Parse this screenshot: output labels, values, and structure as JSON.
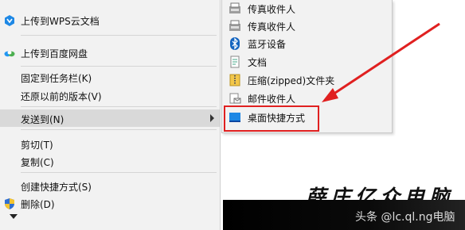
{
  "menu": {
    "items": [
      {
        "label": "上传到WPS云文档",
        "icon": "wps-cloud-icon"
      },
      {
        "label": "上传到百度网盘",
        "icon": "baidu-netdisk-icon"
      },
      {
        "label": "固定到任务栏(K)"
      },
      {
        "label": "还原以前的版本(V)"
      },
      {
        "label": "发送到(N)"
      },
      {
        "label": "剪切(T)"
      },
      {
        "label": "复制(C)"
      },
      {
        "label": "创建快捷方式(S)"
      },
      {
        "label": "删除(D)",
        "icon": "shield-icon"
      }
    ]
  },
  "submenu": {
    "items": [
      {
        "label": "传真收件人",
        "icon": "fax-icon"
      },
      {
        "label": "传真收件人",
        "icon": "fax-icon"
      },
      {
        "label": "蓝牙设备",
        "icon": "bluetooth-icon"
      },
      {
        "label": "文档",
        "icon": "document-icon"
      },
      {
        "label": "压缩(zipped)文件夹",
        "icon": "zip-folder-icon"
      },
      {
        "label": "邮件收件人",
        "icon": "mail-icon"
      },
      {
        "label": "桌面快捷方式",
        "icon": "desktop-icon"
      }
    ]
  },
  "watermark": {
    "title": "薛庄亿众电脑",
    "text": "头条 @lc.ql.ng电脑"
  },
  "colors": {
    "highlight": "#e02020",
    "accent": "#1a73e8"
  }
}
